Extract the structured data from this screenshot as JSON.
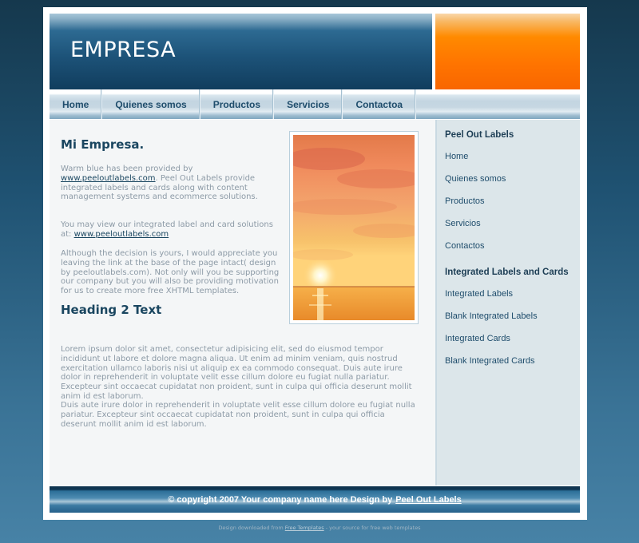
{
  "header": {
    "logo_text": "EMPRESA"
  },
  "nav": {
    "items": [
      "Home",
      "Quienes somos",
      "Productos",
      "Servicios",
      "Contactoa"
    ]
  },
  "main": {
    "title": "Mi Empresa.",
    "p1_before": "Warm blue has been provided by ",
    "p1_link": "www.peeloutlabels.com",
    "p1_after": ". Peel Out Labels provide integrated labels and cards along with content management systems and ecommerce solutions.",
    "p2_before": "You may view our integrated label and card solutions at: ",
    "p2_link": "www.peeloutlabels.com",
    "p3": "Although the decision is yours, I would appreciate you leaving the link at the base of the page intact( design by peeloutlabels.com). Not only will you be supporting our company but you will also be providing motivation for us to create more free XHTML templates.",
    "heading2": "Heading 2 Text",
    "p4": "Lorem ipsum dolor sit amet, consectetur adipisicing elit, sed do eiusmod tempor incididunt ut labore et dolore magna aliqua. Ut enim ad minim veniam, quis nostrud exercitation ullamco laboris nisi ut aliquip ex ea commodo consequat. Duis aute irure dolor in reprehenderit in voluptate velit esse cillum dolore eu fugiat nulla pariatur. Excepteur sint occaecat cupidatat non proident, sunt in culpa qui officia deserunt mollit anim id est laborum.",
    "p5": "Duis aute irure dolor in reprehenderit in voluptate velit esse cillum dolore eu fugiat nulla pariatur. Excepteur sint occaecat cupidatat non proident, sunt in culpa qui officia deserunt mollit anim id est laborum."
  },
  "sidebar": {
    "heading1": "Peel Out Labels",
    "links1": [
      "Home",
      "Quienes somos",
      "Productos",
      "Servicios",
      "Contactos"
    ],
    "heading2": "Integrated Labels and Cards",
    "links2": [
      "Integrated Labels",
      "Blank Integrated Labels",
      "Integrated Cards",
      "Blank Integrated Cards"
    ]
  },
  "footer": {
    "text": "© copyright 2007 Your company name here Design by",
    "link": "Peel Out Labels"
  },
  "credit": {
    "before": "Design downloaded from ",
    "link": "Free Templates",
    "after": " - your source for free web templates"
  },
  "colors": {
    "header_blue": "#1d5379",
    "header_orange": "#ff7a00",
    "title_text": "#1a4660",
    "body_text": "#8c9aa6",
    "sidebar_bg": "#dce6ea"
  }
}
